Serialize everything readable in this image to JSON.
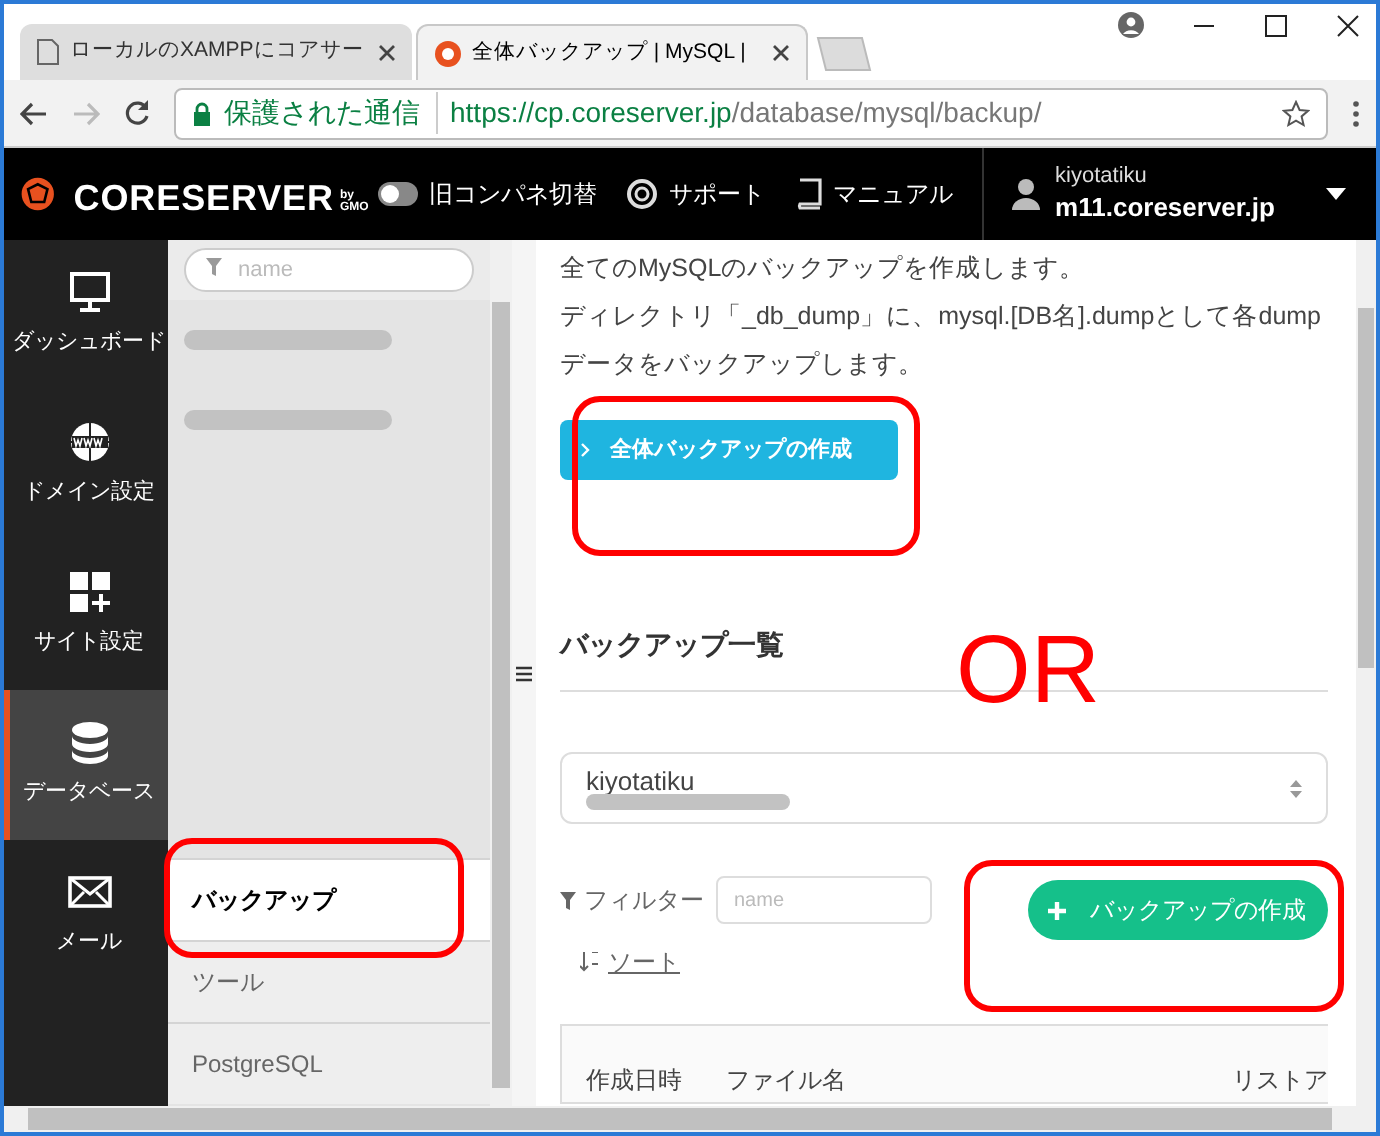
{
  "browser": {
    "tabs": [
      {
        "title": "ローカルのXAMPPにコアサー",
        "selected": false
      },
      {
        "title": "全体バックアップ | MySQL |",
        "selected": true
      }
    ],
    "address": {
      "secure_label": "保護された通信",
      "url_host": "https://cp.coreserver.jp",
      "url_path": "/database/mysql/backup/"
    }
  },
  "header": {
    "brand": "CORESERVER",
    "brand_suffix": "by GMO",
    "nav": [
      {
        "label": "旧コンパネ切替"
      },
      {
        "label": "サポート"
      },
      {
        "label": "マニュアル"
      }
    ],
    "user": {
      "name": "kiyotatiku",
      "host": "m11.coreserver.jp"
    }
  },
  "sidebar": {
    "items": [
      {
        "label": "ダッシュボード",
        "selected": false
      },
      {
        "label": "ドメイン設定",
        "selected": false
      },
      {
        "label": "サイト設定",
        "selected": false
      },
      {
        "label": "データベース",
        "selected": true
      },
      {
        "label": "メール",
        "selected": false
      }
    ]
  },
  "subnav": {
    "search_placeholder": "name",
    "items": [
      {
        "kind": "redacted"
      },
      {
        "kind": "redacted"
      },
      {
        "kind": "link",
        "label": "バックアップ",
        "selected": true
      },
      {
        "kind": "link",
        "label": "ツール",
        "selected": false
      },
      {
        "kind": "link",
        "label": "PostgreSQL",
        "selected": false
      }
    ]
  },
  "content": {
    "description": [
      "全てのMySQLのバックアップを作成します。",
      "ディレクトリ「_db_dump」に、mysql.[DB名].dumpとして各dumpデータをバックアップします。"
    ],
    "create_all_button": "全体バックアップの作成",
    "section_title": "バックアップ一覧",
    "database_select": "kiyotatiku",
    "filter_label": "フィルター",
    "filter_placeholder": "name",
    "sort_label": "ソート",
    "create_button": "バックアップの作成",
    "table": {
      "columns": [
        "作成日時",
        "ファイル名",
        "リストア"
      ]
    }
  },
  "annotation": {
    "text": "OR"
  }
}
